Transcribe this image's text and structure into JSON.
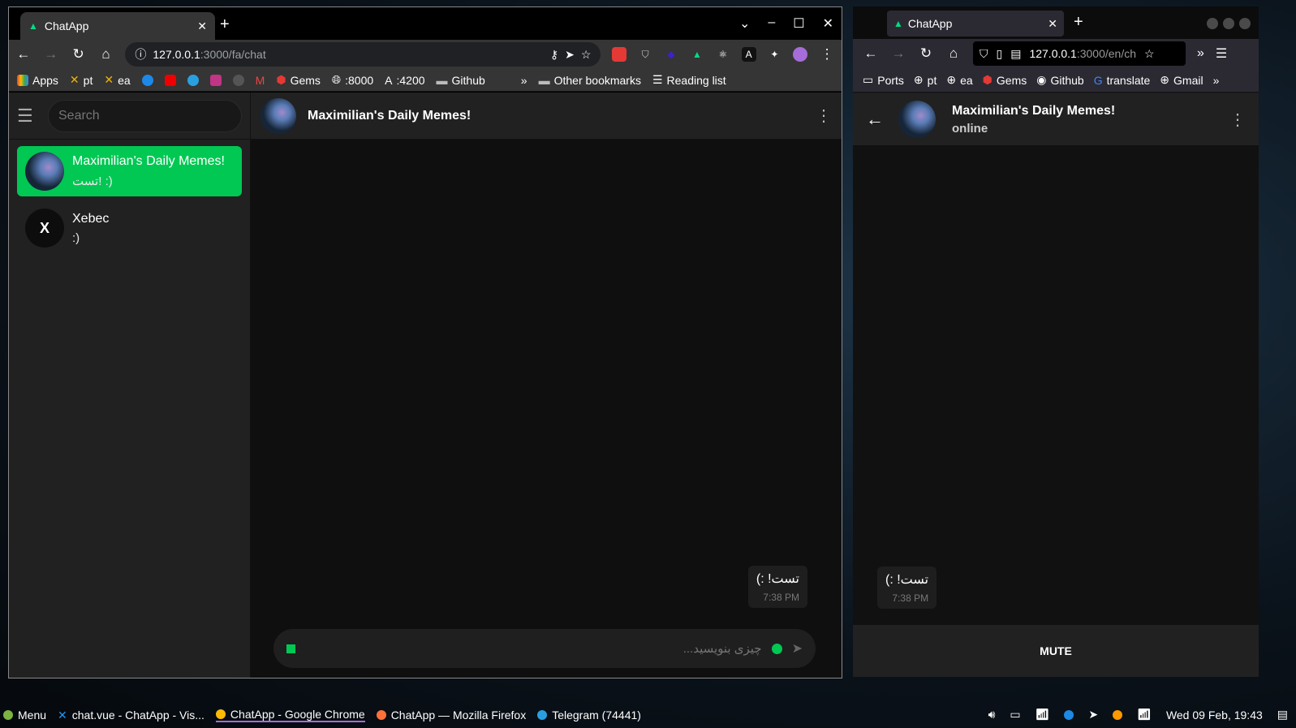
{
  "chrome": {
    "tab_title": "ChatApp",
    "url_host": "127.0.0.1",
    "url_path": ":3000/fa/chat",
    "bookmarks": [
      "Apps",
      "pt",
      "ea",
      "Gems",
      ":8000",
      ":4200",
      "Github"
    ],
    "other_bookmarks": "Other bookmarks",
    "reading_list": "Reading list"
  },
  "sidebar": {
    "search_placeholder": "Search",
    "chats": [
      {
        "name": "Maximilian's Daily Memes!",
        "last": "تست! :)",
        "active": true
      },
      {
        "name": "Xebec",
        "last": ":)",
        "avatar_letter": "X"
      }
    ]
  },
  "main": {
    "title": "Maximilian's Daily Memes!",
    "message": {
      "text": "تست! :)",
      "time": "7:38 PM"
    },
    "composer_placeholder": "چیزی بنویسید..."
  },
  "firefox": {
    "tab_title": "ChatApp",
    "url_host": "127.0.0.1",
    "url_path": ":3000/en/ch",
    "bookmarks": [
      "Ports",
      "pt",
      "ea",
      "Gems",
      "Github",
      "translate",
      "Gmail"
    ],
    "chat_title": "Maximilian's Daily Memes!",
    "status": "online",
    "message": {
      "text": "تست! :)",
      "time": "7:38 PM"
    },
    "mute_label": "MUTE"
  },
  "taskbar": {
    "items": [
      "Menu",
      "chat.vue - ChatApp - Vis...",
      "ChatApp - Google Chrome",
      "ChatApp — Mozilla Firefox",
      "Telegram (74441)"
    ],
    "clock": "Wed 09 Feb, 19:43"
  },
  "colors": {
    "accent": "#00c853"
  }
}
